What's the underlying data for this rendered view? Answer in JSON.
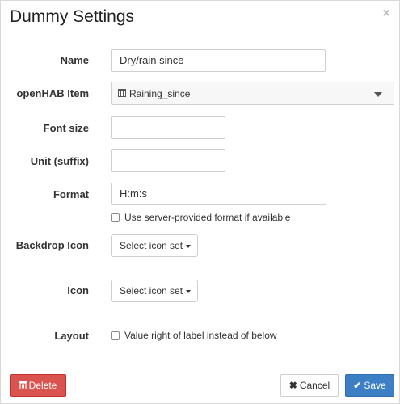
{
  "dialog": {
    "title": "Dummy Settings",
    "close_glyph": "×"
  },
  "fields": {
    "name": {
      "label": "Name",
      "value": "Dry/rain since"
    },
    "item": {
      "label": "openHAB Item",
      "value": "Raining_since",
      "icon": "calendar-icon"
    },
    "font_size": {
      "label": "Font size",
      "value": ""
    },
    "unit": {
      "label": "Unit (suffix)",
      "value": ""
    },
    "format": {
      "label": "Format",
      "value": "H:m:s",
      "server_format_label": "Use server-provided format if available",
      "server_format_checked": false
    },
    "backdrop_icon": {
      "label": "Backdrop Icon",
      "button_label": "Select icon set"
    },
    "icon": {
      "label": "Icon",
      "button_label": "Select icon set"
    },
    "layout": {
      "label": "Layout",
      "checkbox_label": "Value right of label instead of below",
      "checked": false
    }
  },
  "footer": {
    "delete_label": "Delete",
    "cancel_label": "Cancel",
    "save_label": "Save",
    "delete_icon": "trash-icon",
    "cancel_icon": "x-icon",
    "save_icon": "checkmark-icon"
  },
  "colors": {
    "delete": "#d9534f",
    "save": "#3c7fc4"
  }
}
